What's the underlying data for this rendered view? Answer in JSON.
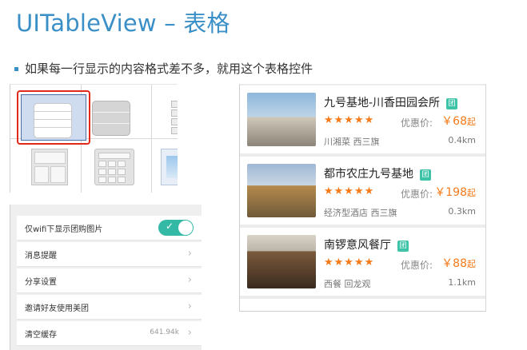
{
  "slide": {
    "title": "UITableView – 表格",
    "bullet": "如果每一行显示的内容格式差不多，就用这个表格控件"
  },
  "style_picker": {
    "icons": [
      "table-view-icon",
      "grouped-table-icon",
      "grid-view-icon",
      "collection-view-icon",
      "calculator-icon",
      "image-view-icon"
    ]
  },
  "settings": {
    "rows": [
      {
        "label": "仅wifi下显示团购图片",
        "toggle": true
      },
      {
        "label": "消息提醒"
      },
      {
        "label": "分享设置"
      },
      {
        "label": "邀请好友使用美团"
      },
      {
        "label": "清空缓存",
        "value": "641.94k"
      }
    ]
  },
  "listings": {
    "tag": "团",
    "price_label": "优惠价:",
    "price_unit": "起",
    "items": [
      {
        "name": "九号基地-川香田园会所",
        "stars": "★★★★★",
        "price": "￥68",
        "category": "川湘菜 西三旗",
        "distance": "0.4km"
      },
      {
        "name": "都市农庄九号基地",
        "stars": "★★★★★",
        "price": "￥198",
        "category": "经济型酒店 西三旗",
        "distance": "0.3km"
      },
      {
        "name": "南锣意风餐厅",
        "stars": "★★★★★",
        "price": "￥88",
        "category": "西餐 回龙观",
        "distance": "1.1km"
      }
    ]
  },
  "colors": {
    "accent": "#3a8fc7",
    "price": "#f47a1a",
    "toggle": "#33b9a6",
    "selection": "#e02a1b"
  }
}
